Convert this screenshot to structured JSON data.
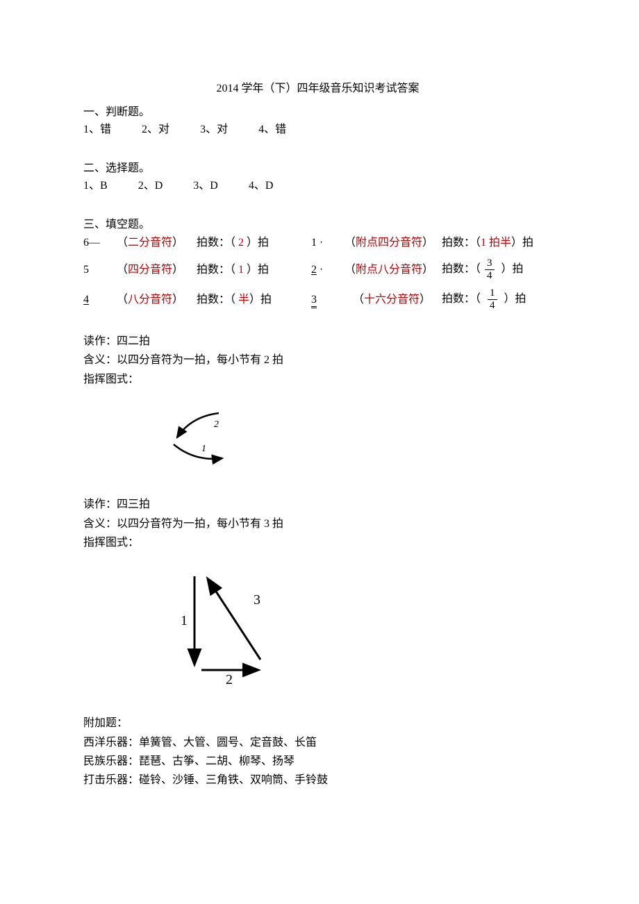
{
  "title": "2014 学年（下）四年级音乐知识考试答案",
  "section1": {
    "header": "一、判断题。",
    "items": [
      {
        "num": "1、",
        "ans": "错"
      },
      {
        "num": "2、",
        "ans": "对"
      },
      {
        "num": "3、",
        "ans": "对"
      },
      {
        "num": "4、",
        "ans": "错"
      }
    ]
  },
  "section2": {
    "header": "二、选择题。",
    "items": [
      {
        "num": "1、",
        "ans": "B"
      },
      {
        "num": "2、",
        "ans": "D"
      },
      {
        "num": "3、",
        "ans": "D"
      },
      {
        "num": "4、",
        "ans": "D"
      }
    ]
  },
  "section3": {
    "header": "三、填空题。",
    "rows": [
      {
        "left_note": "6—",
        "left_name": "二分音符",
        "left_beats_pre": "拍数：（ ",
        "left_beats_val": "2",
        "left_beats_post": " ）拍",
        "right_note": "1 ·",
        "right_name": "附点四分音符",
        "right_beats_pre": "拍数：（",
        "right_beats_val": "1 拍半",
        "right_beats_post": "）拍"
      },
      {
        "left_note": "5",
        "left_name": "四分音符",
        "left_beats_pre": "拍数：（ ",
        "left_beats_val": "1",
        "left_beats_post": " ）拍",
        "right_note_underline": "2",
        "right_note_suffix": " ·",
        "right_name": "附点八分音符",
        "right_beats_pre": "拍数：（",
        "right_frac_num": "3",
        "right_frac_den": "4",
        "right_beats_post": "）拍"
      },
      {
        "left_note_underline": "4",
        "left_name": "八分音符",
        "left_beats_pre": "拍数：（ ",
        "left_beats_val": "半",
        "left_beats_post": "）拍",
        "right_note_double": "3",
        "right_name": "十六分音符",
        "right_beats_pre": "拍数：（",
        "right_frac_num": "1",
        "right_frac_den": "4",
        "right_beats_post": "）拍"
      }
    ]
  },
  "meter1": {
    "read": "读作：四二拍",
    "meaning": "含义：以四分音符为一拍，每小节有 2 拍",
    "pattern": "指挥图式："
  },
  "meter2": {
    "read": "读作：四三拍",
    "meaning": "含义：以四分音符为一拍，每小节有 3 拍",
    "pattern": "指挥图式："
  },
  "extra": {
    "header": "附加题：",
    "lines": [
      "西洋乐器：单簧管、大管、圆号、定音鼓、长笛",
      "民族乐器：琵琶、古筝、二胡、柳琴、扬琴",
      "打击乐器：碰铃、沙锤、三角铁、双响筒、手铃鼓"
    ]
  }
}
